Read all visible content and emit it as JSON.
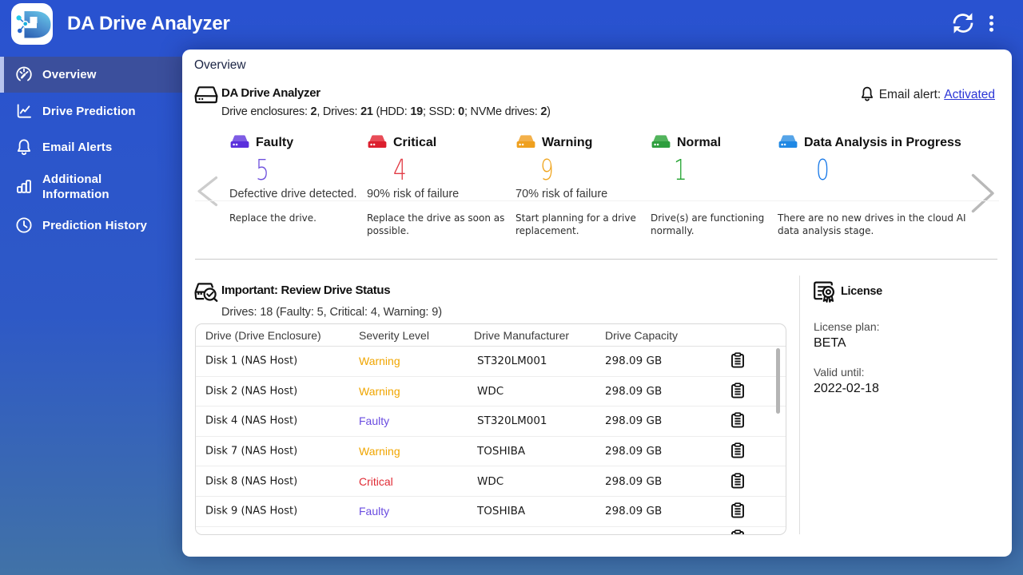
{
  "topbar": {
    "title": "DA Drive Analyzer",
    "refresh_icon": "refresh-icon",
    "menu_icon": "kebab-menu-icon"
  },
  "sidebar": {
    "items": [
      {
        "label": "Overview",
        "icon": "gauge-icon",
        "active": true
      },
      {
        "label": "Drive Prediction",
        "icon": "trend-icon",
        "active": false
      },
      {
        "label": "Email Alerts",
        "icon": "bell-icon",
        "active": false
      },
      {
        "label": "Additional Information",
        "icon": "bar-chart-icon",
        "active": false
      },
      {
        "label": "Prediction History",
        "icon": "clock-icon",
        "active": false
      }
    ]
  },
  "page": {
    "title": "Overview"
  },
  "summary": {
    "title": "DA Drive Analyzer",
    "info_segments": [
      {
        "t": "Drive enclosures: "
      },
      {
        "t": "2",
        "b": true
      },
      {
        "t": ", Drives: "
      },
      {
        "t": "21",
        "b": true
      },
      {
        "t": " (HDD: "
      },
      {
        "t": "19",
        "b": true
      },
      {
        "t": "; SSD: "
      },
      {
        "t": "0",
        "b": true
      },
      {
        "t": "; NVMe drives: "
      },
      {
        "t": "2",
        "b": true
      },
      {
        "t": ")"
      }
    ],
    "email_alert_label": "Email alert: ",
    "email_alert_status": "Activated"
  },
  "status_cards": [
    {
      "title": "Faulty",
      "count": "5",
      "color": "#6e50dd",
      "icon_top": "#7e5ce4",
      "icon_front": "#5a2fdc",
      "desc1": "Defective drive detected.",
      "desc2": "Replace the drive."
    },
    {
      "title": "Critical",
      "count": "4",
      "color": "#e23b45",
      "icon_top": "#e84c57",
      "icon_front": "#dc1f2e",
      "desc1": "90% risk of failure",
      "desc2": "Replace the drive as soon as possible."
    },
    {
      "title": "Warning",
      "count": "9",
      "color": "#f0a51e",
      "icon_top": "#f3b04a",
      "icon_front": "#efa01e",
      "desc1": "70% risk of failure",
      "desc2": "Start planning for a drive replacement."
    },
    {
      "title": "Normal",
      "count": "1",
      "color": "#21a22f",
      "icon_top": "#52b45c",
      "icon_front": "#2e9e3e",
      "desc1": "",
      "desc2": "Drive(s) are functioning normally."
    },
    {
      "title": "Data Analysis in Progress",
      "count": "0",
      "color": "#1778e8",
      "icon_top": "#55a4e8",
      "icon_front": "#1f88e4",
      "desc1": "",
      "desc2": "There are no new drives in the cloud AI data analysis stage."
    }
  ],
  "important": {
    "title": "Important: Review Drive Status",
    "subtitle": "Drives: 18 (Faulty: 5, Critical: 4, Warning: 9)"
  },
  "drive_table": {
    "headers": [
      "Drive (Drive Enclosure)",
      "Severity Level",
      "Drive Manufacturer",
      "Drive Capacity"
    ],
    "rows": [
      {
        "drive": "Disk 1 (NAS Host)",
        "severity": "Warning",
        "sev_key": "warning",
        "manufacturer": "ST320LM001",
        "capacity": "298.09 GB"
      },
      {
        "drive": "Disk 2 (NAS Host)",
        "severity": "Warning",
        "sev_key": "warning",
        "manufacturer": "WDC",
        "capacity": "298.09 GB"
      },
      {
        "drive": "Disk 4 (NAS Host)",
        "severity": "Faulty",
        "sev_key": "faulty",
        "manufacturer": "ST320LM001",
        "capacity": "298.09 GB"
      },
      {
        "drive": "Disk 7 (NAS Host)",
        "severity": "Warning",
        "sev_key": "warning",
        "manufacturer": "TOSHIBA",
        "capacity": "298.09 GB"
      },
      {
        "drive": "Disk 8 (NAS Host)",
        "severity": "Critical",
        "sev_key": "critical",
        "manufacturer": "WDC",
        "capacity": "298.09 GB"
      },
      {
        "drive": "Disk 9 (NAS Host)",
        "severity": "Faulty",
        "sev_key": "faulty",
        "manufacturer": "TOSHIBA",
        "capacity": "298.09 GB"
      },
      {
        "drive": "",
        "severity": "",
        "sev_key": "",
        "manufacturer": "",
        "capacity": ""
      }
    ],
    "partial_last_row_visible": true
  },
  "colors": {
    "warning": "#f0a500",
    "faulty": "#6a4ce0",
    "critical": "#e02b35"
  },
  "license": {
    "title": "License",
    "plan_label": "License plan:",
    "plan": "BETA",
    "valid_label": "Valid until:",
    "valid": "2022-02-18"
  }
}
